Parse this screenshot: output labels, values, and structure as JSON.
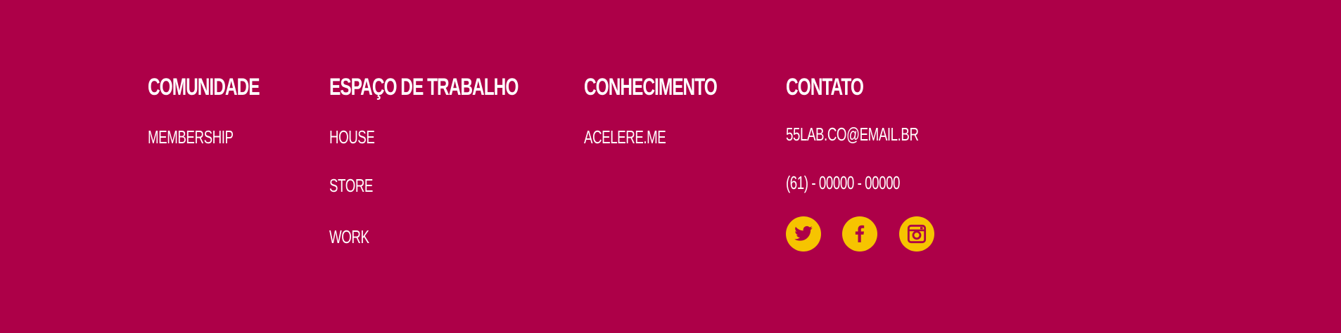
{
  "colors": {
    "background": "#ad0048",
    "text": "#ffffff",
    "icon_circle": "#f6c400",
    "icon_glyph": "#ad0048"
  },
  "footer": {
    "columns": [
      {
        "title": "COMUNIDADE",
        "links": [
          "MEMBERSHIP"
        ]
      },
      {
        "title": "ESPAÇO DE TRABALHO",
        "links": [
          "HOUSE",
          "STORE",
          "WORK"
        ]
      },
      {
        "title": "CONHECIMENTO",
        "links": [
          "ACELERE.ME"
        ]
      },
      {
        "title": "CONTATO",
        "links": [
          "55LAB.CO@EMAIL.BR",
          "(61) - 00000 - 00000"
        ]
      }
    ],
    "social": [
      {
        "icon": "twitter-icon"
      },
      {
        "icon": "facebook-icon"
      },
      {
        "icon": "instagram-icon"
      }
    ]
  }
}
